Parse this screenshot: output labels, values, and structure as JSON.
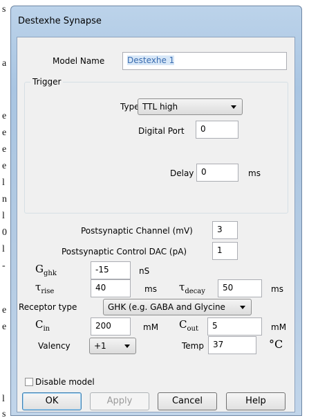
{
  "background_letters": [
    "s",
    "a",
    "e",
    "e",
    "e",
    "e",
    "l",
    "n",
    "l",
    "0",
    "l",
    "-",
    "e",
    "e",
    "l",
    "s"
  ],
  "dialog": {
    "title": "Destexhe Synapse",
    "model_name_label": "Model Name",
    "model_name_value": "Destexhe 1",
    "trigger_group_label": "Trigger",
    "type_label": "Type",
    "type_value": "TTL high",
    "digital_port_label": "Digital Port",
    "digital_port_value": "0",
    "delay_label": "Delay",
    "delay_value": "0",
    "delay_unit": "ms",
    "post_channel_label": "Postsynaptic Channel (mV)",
    "post_channel_value": "3",
    "post_dac_label": "Postsynaptic Control DAC (pA)",
    "post_dac_value": "1",
    "gghk_symbol": "G",
    "gghk_sub": "ghk",
    "gghk_value": "-15",
    "gghk_unit": "nS",
    "tau_symbol": "τ",
    "tau_rise_sub": "rise",
    "tau_rise_value": "40",
    "tau_rise_unit": "ms",
    "tau_decay_sub": "decay",
    "tau_decay_value": "50",
    "tau_decay_unit": "ms",
    "receptor_label": "Receptor type",
    "receptor_value": "GHK (e.g. GABA and Glycine",
    "cin_symbol": "C",
    "cin_sub": "in",
    "cin_value": "200",
    "cin_unit": "mM",
    "cout_symbol": "C",
    "cout_sub": "out",
    "cout_value": "5",
    "cout_unit": "mM",
    "valency_label": "Valency",
    "valency_value": "+1",
    "temp_label": "Temp",
    "temp_value": "37",
    "temp_unit": "°C",
    "disable_label": "Disable model",
    "disable_checked": false,
    "buttons": {
      "ok": "OK",
      "apply": "Apply",
      "cancel": "Cancel",
      "help": "Help"
    }
  }
}
